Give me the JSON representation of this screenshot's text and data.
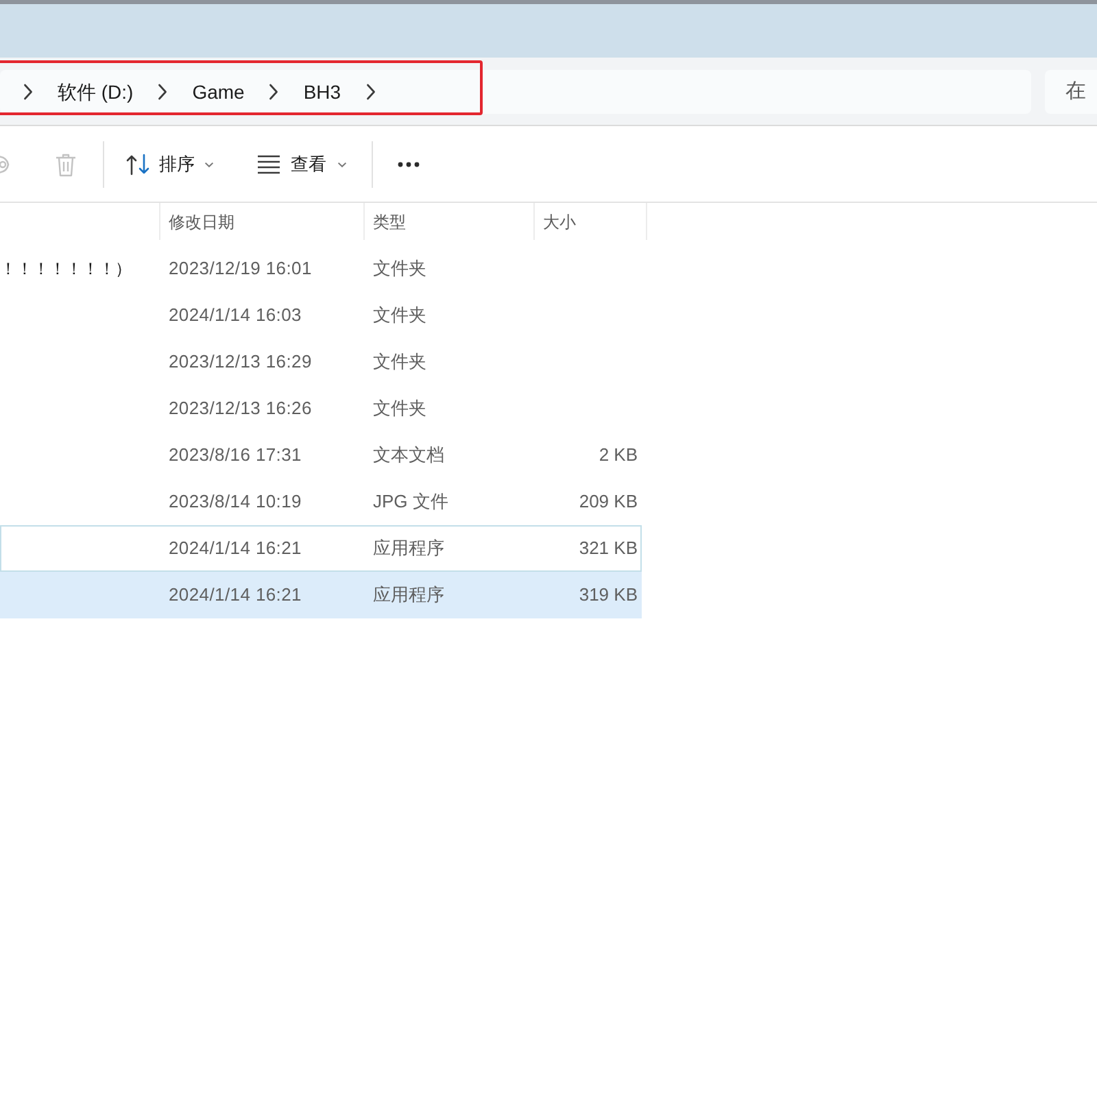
{
  "address_bar": {
    "breadcrumbs": [
      {
        "label": "软件 (D:)"
      },
      {
        "label": "Game"
      },
      {
        "label": "BH3"
      }
    ]
  },
  "search": {
    "placeholder": "在"
  },
  "toolbar": [
    {
      "kind": "clipped",
      "disabled": true
    },
    {
      "kind": "delete",
      "disabled": true
    },
    {
      "kind": "divider"
    },
    {
      "kind": "sort",
      "label": "排序"
    },
    {
      "kind": "view",
      "label": "查看"
    },
    {
      "kind": "divider"
    },
    {
      "kind": "more"
    }
  ],
  "table": {
    "columns": [
      {
        "label": "修改日期"
      },
      {
        "label": "类型"
      },
      {
        "label": "大小"
      }
    ],
    "rows": [
      {
        "name": "！！！！！！！）",
        "modified": "2023/12/19 16:01",
        "type": "文件夹",
        "selected": false,
        "focused": false
      },
      {
        "modified": "2024/1/14 16:03",
        "type": "文件夹",
        "selected": false,
        "focused": false
      },
      {
        "modified": "2023/12/13 16:29",
        "type": "文件夹",
        "selected": false,
        "focused": false
      },
      {
        "modified": "2023/12/13 16:26",
        "type": "文件夹",
        "selected": false,
        "focused": false
      },
      {
        "modified": "2023/8/16 17:31",
        "type": "文本文档",
        "size": "2 KB",
        "selected": false,
        "focused": false
      },
      {
        "modified": "2023/8/14 10:19",
        "type": "JPG 文件",
        "size": "209 KB",
        "selected": false,
        "focused": false
      },
      {
        "modified": "2024/1/14 16:21",
        "type": "应用程序",
        "size": "321 KB",
        "selected": false,
        "focused": true
      },
      {
        "modified": "2024/1/14 16:21",
        "type": "应用程序",
        "size": "319 KB",
        "selected": true,
        "focused": false
      }
    ]
  }
}
